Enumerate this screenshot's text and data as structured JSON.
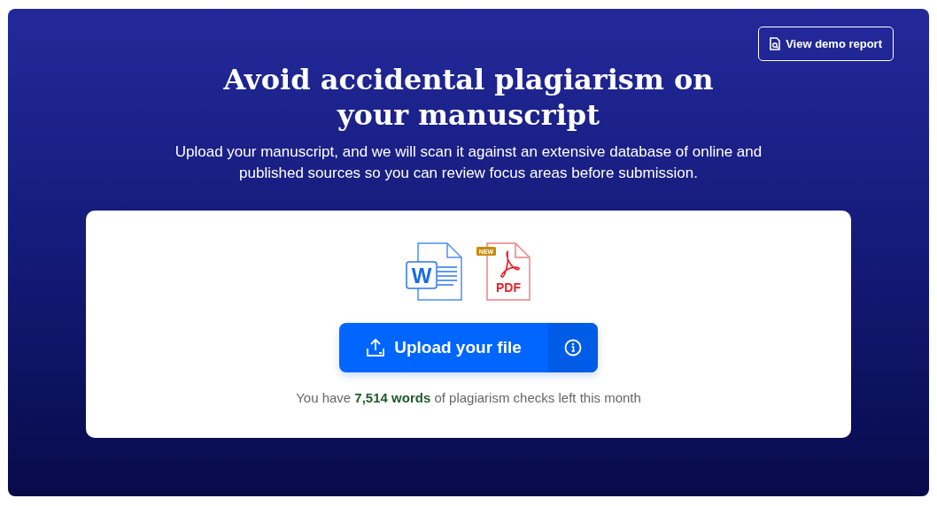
{
  "demo_button": {
    "label": "View demo report"
  },
  "heading": "Avoid accidental plagiarism on your manuscript",
  "subtitle": "Upload your manuscript, and we will scan it against an extensive database of online and published sources so you can review focus areas before submission.",
  "file_types": [
    {
      "kind": "word",
      "label": "W"
    },
    {
      "kind": "pdf",
      "label": "PDF",
      "badge": "NEW"
    }
  ],
  "upload_button": {
    "label": "Upload your file"
  },
  "quota_text": "You have **7,514 words** of plagiarism checks left this month"
}
